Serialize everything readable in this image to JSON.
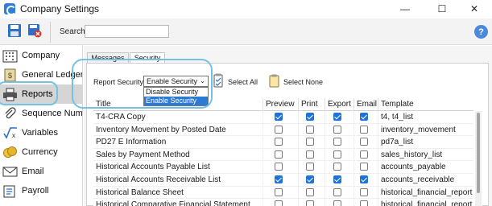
{
  "window": {
    "title": "Company Settings",
    "minimize": "—",
    "maximize": "☐",
    "close": "✕"
  },
  "toolbar": {
    "search_label": "Search",
    "search_value": ""
  },
  "sidebar": {
    "items": [
      {
        "label": "Company",
        "icon": "building-icon"
      },
      {
        "label": "General Ledger",
        "icon": "ledger-icon"
      },
      {
        "label": "Reports",
        "icon": "printer-icon",
        "selected": true
      },
      {
        "label": "Sequence Numbers",
        "icon": "paperclip-icon"
      },
      {
        "label": "Variables",
        "icon": "variables-icon"
      },
      {
        "label": "Currency",
        "icon": "currency-icon"
      },
      {
        "label": "Email",
        "icon": "email-icon"
      },
      {
        "label": "Payroll",
        "icon": "payroll-icon"
      }
    ]
  },
  "tabs": {
    "messages": "Messages",
    "security": "Security"
  },
  "security": {
    "label": "Report Security",
    "selected_value": "Enable Security",
    "options": [
      "Disable Security",
      "Enable Security"
    ],
    "select_all": "Select All",
    "select_none": "Select None"
  },
  "grid": {
    "columns": [
      "Title",
      "Preview",
      "Print",
      "Export",
      "Email",
      "Template"
    ],
    "rows": [
      {
        "title": "T4-CRA Copy",
        "preview": true,
        "print": true,
        "export": true,
        "email": true,
        "template": "t4, t4_list"
      },
      {
        "title": "Inventory Movement by Posted Date",
        "preview": false,
        "print": false,
        "export": false,
        "email": false,
        "template": "inventory_movement"
      },
      {
        "title": "PD27 E Information",
        "preview": false,
        "print": false,
        "export": false,
        "email": false,
        "template": "pd7a_list"
      },
      {
        "title": "Sales by Payment Method",
        "preview": false,
        "print": false,
        "export": false,
        "email": false,
        "template": "sales_history_list"
      },
      {
        "title": "Historical Accounts Payable List",
        "preview": false,
        "print": false,
        "export": false,
        "email": false,
        "template": "accounts_payable"
      },
      {
        "title": "Historical Accounts Receivable List",
        "preview": true,
        "print": true,
        "export": true,
        "email": true,
        "template": "accounts_receivable"
      },
      {
        "title": "Historical Balance Sheet",
        "preview": false,
        "print": false,
        "export": false,
        "email": false,
        "template": "historical_financial_report"
      },
      {
        "title": "Historical Comparative Financial Statement",
        "preview": false,
        "print": false,
        "export": false,
        "email": false,
        "template": "historical_financial_report"
      }
    ]
  },
  "colors": {
    "accent": "#1f72d8",
    "focus_ring": "#74c1e3",
    "selected_row": "#d5d5d5"
  }
}
